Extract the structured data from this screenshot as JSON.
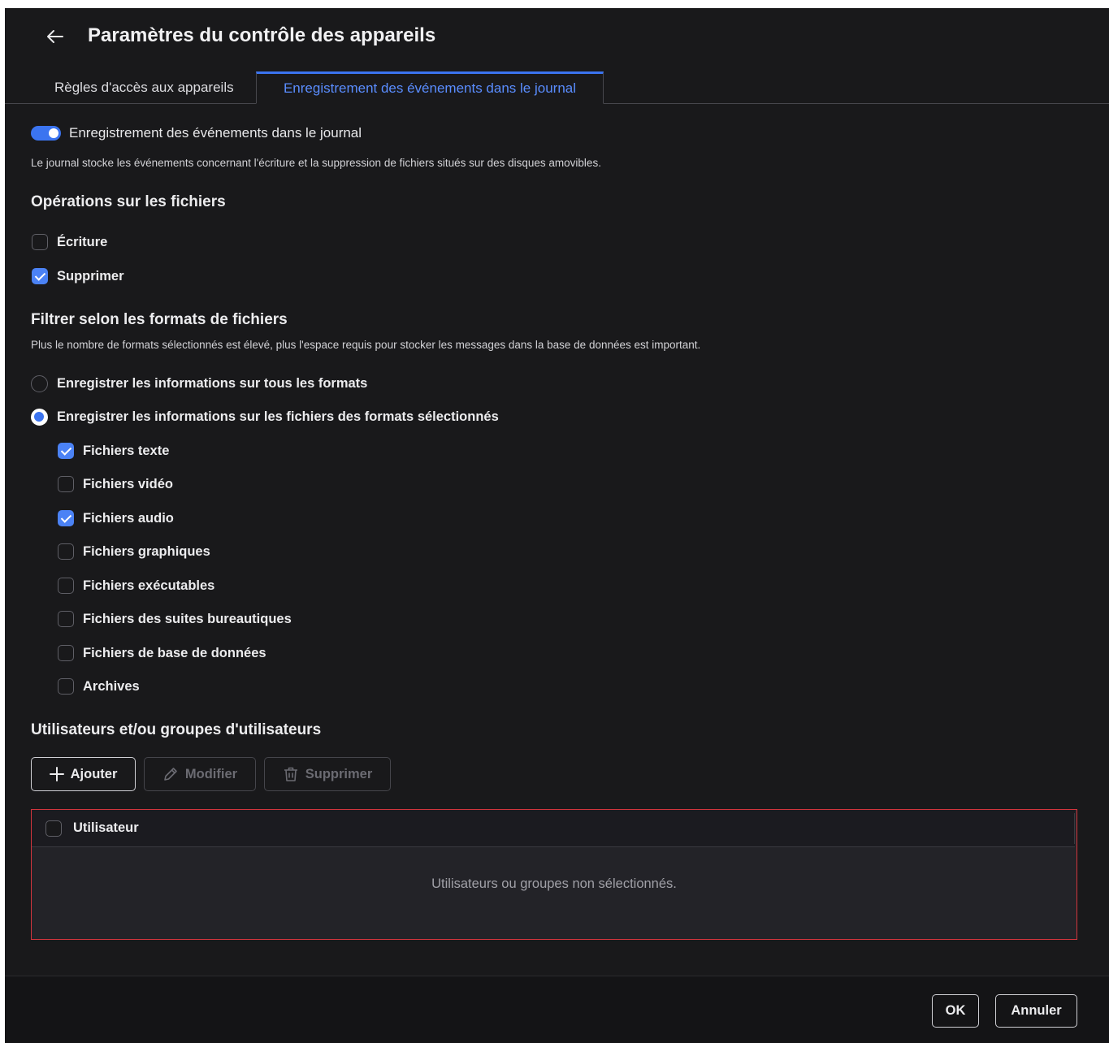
{
  "header": {
    "title": "Paramètres du contrôle des appareils",
    "back_icon": "arrow-left-icon"
  },
  "tabs": [
    {
      "label": "Règles d'accès aux appareils",
      "active": false
    },
    {
      "label": "Enregistrement des événements dans le journal",
      "active": true
    }
  ],
  "logging": {
    "toggle_label": "Enregistrement des événements dans le journal",
    "toggle_on": true,
    "description": "Le journal stocke les événements concernant l'écriture et la suppression de fichiers situés sur des disques amovibles."
  },
  "file_operations": {
    "title": "Opérations sur les fichiers",
    "items": [
      {
        "label": "Écriture",
        "checked": false
      },
      {
        "label": "Supprimer",
        "checked": true
      }
    ]
  },
  "format_filter": {
    "title": "Filtrer selon les formats de fichiers",
    "description": "Plus le nombre de formats sélectionnés est élevé, plus l'espace requis pour stocker les messages dans la base de données est important.",
    "radio_all": {
      "label": "Enregistrer les informations sur tous les formats",
      "checked": false
    },
    "radio_selected": {
      "label": "Enregistrer les informations sur les fichiers des formats sélectionnés",
      "checked": true
    },
    "formats": [
      {
        "label": "Fichiers texte",
        "checked": true
      },
      {
        "label": "Fichiers vidéo",
        "checked": false
      },
      {
        "label": "Fichiers audio",
        "checked": true
      },
      {
        "label": "Fichiers graphiques",
        "checked": false
      },
      {
        "label": "Fichiers exécutables",
        "checked": false
      },
      {
        "label": "Fichiers des suites bureautiques",
        "checked": false
      },
      {
        "label": "Fichiers de base de données",
        "checked": false
      },
      {
        "label": "Archives",
        "checked": false
      }
    ]
  },
  "users": {
    "title": "Utilisateurs et/ou groupes d'utilisateurs",
    "toolbar": {
      "add_label": "Ajouter",
      "edit_label": "Modifier",
      "delete_label": "Supprimer"
    },
    "table": {
      "column_header": "Utilisateur",
      "empty_message": "Utilisateurs ou groupes non sélectionnés."
    }
  },
  "footer": {
    "ok_label": "OK",
    "cancel_label": "Annuler"
  },
  "colors": {
    "accent": "#3b74f0",
    "background": "#19191b",
    "error_border": "#d2353d"
  }
}
